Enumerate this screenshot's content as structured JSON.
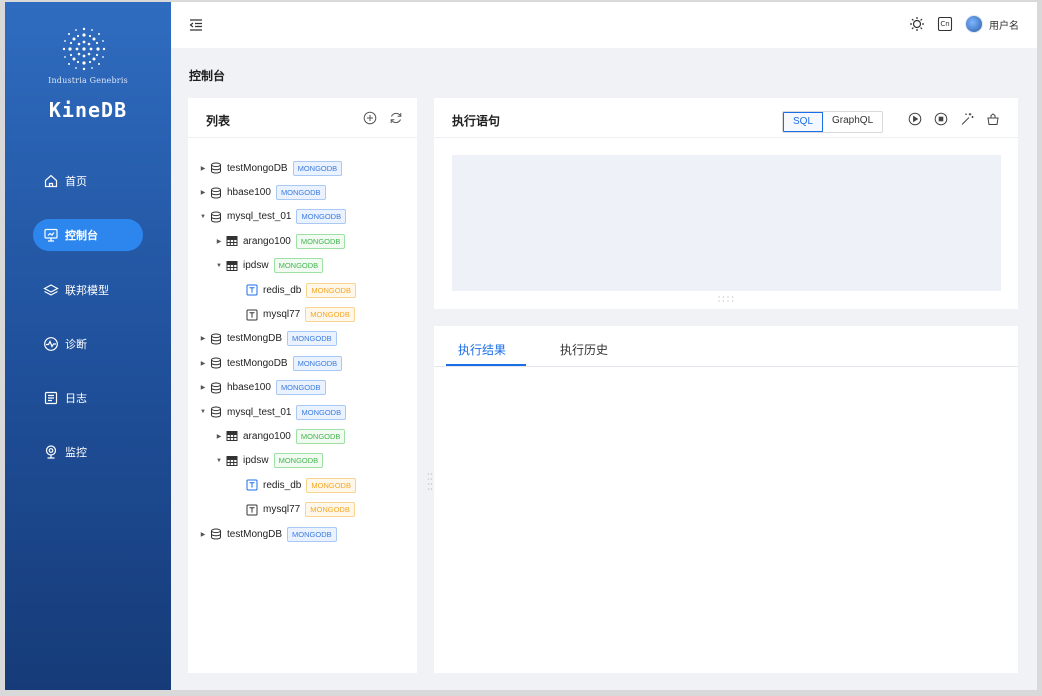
{
  "brand": {
    "subtitle": "Industria Genebris",
    "name": "KineDB"
  },
  "sidebar": {
    "items": [
      {
        "label": "首页",
        "icon": "home-icon",
        "active": false
      },
      {
        "label": "控制台",
        "icon": "monitor-icon",
        "active": true
      },
      {
        "label": "联邦模型",
        "icon": "layers-icon",
        "active": false
      },
      {
        "label": "诊断",
        "icon": "pulse-icon",
        "active": false
      },
      {
        "label": "日志",
        "icon": "log-icon",
        "active": false
      },
      {
        "label": "监控",
        "icon": "webcam-icon",
        "active": false
      }
    ]
  },
  "topbar": {
    "lang_badge": "Cn",
    "username": "用户名"
  },
  "page": {
    "title": "控制台"
  },
  "list_panel": {
    "title": "列表",
    "tree": [
      {
        "label": "testMongoDB",
        "tag": "MONGODB",
        "tag_color": "blue",
        "type": "database",
        "level": 0,
        "expanded": false
      },
      {
        "label": "hbase100",
        "tag": "MONGODB",
        "tag_color": "blue",
        "type": "database",
        "level": 0,
        "expanded": false
      },
      {
        "label": "mysql_test_01",
        "tag": "MONGODB",
        "tag_color": "blue",
        "type": "database",
        "level": 0,
        "expanded": true
      },
      {
        "label": "arango100",
        "tag": "MONGODB",
        "tag_color": "green",
        "type": "table",
        "level": 1,
        "expanded": false
      },
      {
        "label": "ipdsw",
        "tag": "MONGODB",
        "tag_color": "green",
        "type": "table",
        "level": 1,
        "expanded": true
      },
      {
        "label": "redis_db",
        "tag": "MONGODB",
        "tag_color": "orange",
        "type": "text",
        "level": 2,
        "active": true
      },
      {
        "label": "mysql77",
        "tag": "MONGODB",
        "tag_color": "orange",
        "type": "text",
        "level": 2,
        "active": false
      },
      {
        "label": "testMongDB",
        "tag": "MONGODB",
        "tag_color": "blue",
        "type": "database",
        "level": 0,
        "expanded": false
      },
      {
        "label": "testMongoDB",
        "tag": "MONGODB",
        "tag_color": "blue",
        "type": "database",
        "level": 0,
        "expanded": false
      },
      {
        "label": "hbase100",
        "tag": "MONGODB",
        "tag_color": "blue",
        "type": "database",
        "level": 0,
        "expanded": false
      },
      {
        "label": "mysql_test_01",
        "tag": "MONGODB",
        "tag_color": "blue",
        "type": "database",
        "level": 0,
        "expanded": true
      },
      {
        "label": "arango100",
        "tag": "MONGODB",
        "tag_color": "green",
        "type": "table",
        "level": 1,
        "expanded": false
      },
      {
        "label": "ipdsw",
        "tag": "MONGODB",
        "tag_color": "green",
        "type": "table",
        "level": 1,
        "expanded": true
      },
      {
        "label": "redis_db",
        "tag": "MONGODB",
        "tag_color": "orange",
        "type": "text",
        "level": 2,
        "active": true
      },
      {
        "label": "mysql77",
        "tag": "MONGODB",
        "tag_color": "orange",
        "type": "text",
        "level": 2,
        "active": false
      },
      {
        "label": "testMongDB",
        "tag": "MONGODB",
        "tag_color": "blue",
        "type": "database",
        "level": 0,
        "expanded": false
      }
    ]
  },
  "query_panel": {
    "title": "执行语句",
    "modes": [
      {
        "label": "SQL",
        "active": true
      },
      {
        "label": "GraphQL",
        "active": false
      }
    ]
  },
  "result_panel": {
    "tabs": [
      {
        "label": "执行结果",
        "active": true
      },
      {
        "label": "执行历史",
        "active": false
      }
    ]
  },
  "colors": {
    "accent": "#1a6fe8",
    "sidebar_top": "#2f6cc0",
    "sidebar_bottom": "#163b78",
    "tag_blue": "#3b7be0",
    "tag_green": "#43b54f",
    "tag_orange": "#f5a623"
  }
}
